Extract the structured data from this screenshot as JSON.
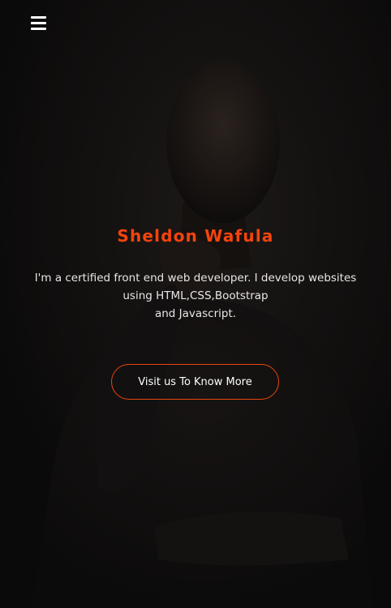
{
  "nav": {
    "menu_icon": "hamburger-menu-icon"
  },
  "hero": {
    "name": "Sheldon Wafula",
    "description_lines": [
      "I'm a certified front end web developer. I develop websites",
      "using HTML,CSS,Bootstrap",
      "and Javascript."
    ],
    "cta_label": "Visit us To Know More"
  },
  "colors": {
    "accent": "#f5430c",
    "background": "#0b0a0a",
    "text": "#e9e6e4"
  }
}
